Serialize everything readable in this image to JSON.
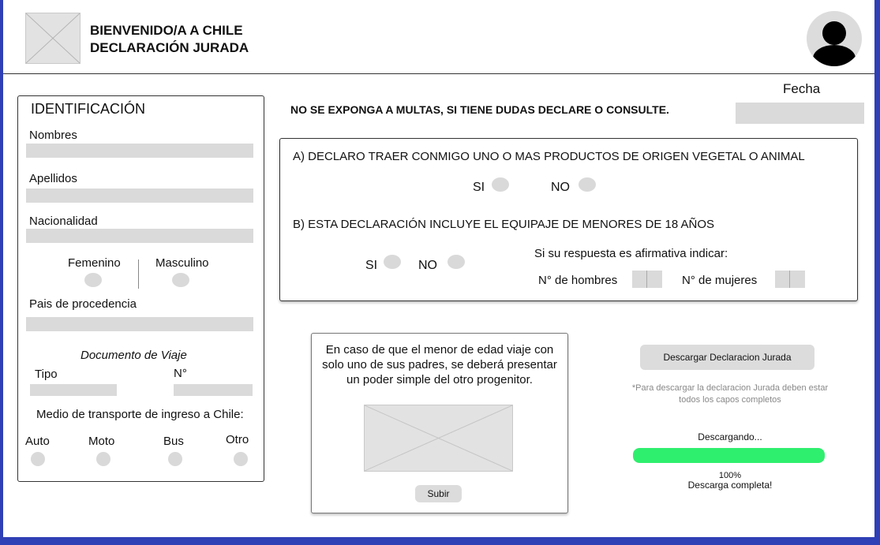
{
  "header": {
    "title_line1": "BIENVENIDO/A A CHILE",
    "title_line2": "DECLARACIÓN JURADA",
    "logo_icon": "image-placeholder-icon",
    "avatar_icon": "user-icon"
  },
  "date_label": "Fecha",
  "warning": "NO SE EXPONGA A MULTAS, SI TIENE DUDAS DECLARE O CONSULTE.",
  "identification": {
    "title": "IDENTIFICACIÓN",
    "nombres_label": "Nombres",
    "apellidos_label": "Apellidos",
    "nacionalidad_label": "Nacionalidad",
    "femenino_label": "Femenino",
    "masculino_label": "Masculino",
    "pais_label": "Pais de procedencia",
    "documento_label": "Documento de Viaje",
    "tipo_label": "Tipo",
    "numero_label": "N°",
    "transporte_label": "Medio de transporte de ingreso a Chile:",
    "transport_options": [
      "Auto",
      "Moto",
      "Bus",
      "Otro"
    ]
  },
  "declaration": {
    "question_a": "A) DECLARO TRAER CONMIGO UNO O MAS PRODUCTOS DE ORIGEN VEGETAL O ANIMAL",
    "question_b": "B) ESTA DECLARACIÓN INCLUYE EL EQUIPAJE DE MENORES DE 18 AÑOS",
    "si_label": "SI",
    "no_label": "NO",
    "affirmative_note": "Si su respuesta es afirmativa indicar:",
    "hombres_label": "N° de hombres",
    "mujeres_label": "N° de mujeres"
  },
  "minor_notice": {
    "text": "En caso de que el menor de edad viaje con solo uno de sus padres, se deberá presentar un poder simple del otro progenitor.",
    "upload_button": "Subir"
  },
  "download": {
    "button": "Descargar Declaracion Jurada",
    "note": "*Para descargar la declaracion Jurada deben estar todos los capos completos",
    "status": "Descargando...",
    "progress": 1.0,
    "progress_color": "#2fef6e",
    "percent": "100%",
    "complete": "Descarga completa!"
  }
}
